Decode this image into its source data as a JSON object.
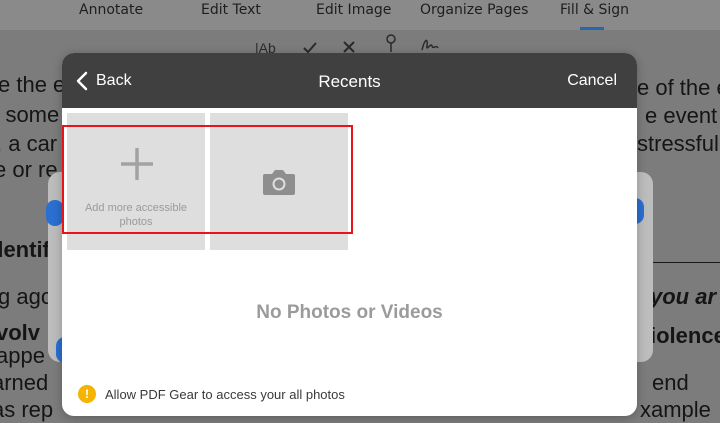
{
  "top_tabs": {
    "items": [
      {
        "label": "Annotate"
      },
      {
        "label": "Edit Text"
      },
      {
        "label": "Edit Image"
      },
      {
        "label": "Organize Pages"
      },
      {
        "label": "Fill & Sign"
      }
    ],
    "active_index": 4,
    "accent_color": "#2866b5"
  },
  "sign_tools": {
    "icons": [
      "text-tool-icon",
      "checkmark-icon",
      "cross-icon",
      "pen-icon",
      "signature-icon"
    ],
    "text_tool_label": "|Ab"
  },
  "background_document": {
    "lines": [
      {
        "text": "e the eve"
      },
      {
        "text": "r some"
      },
      {
        "text": ", a car"
      },
      {
        "text": "e or re"
      },
      {
        "text": "dentif"
      },
      {
        "text": "g ago"
      },
      {
        "text": "volv"
      },
      {
        "text": "appe"
      },
      {
        "text": "arned"
      },
      {
        "text": "as rep"
      },
      {
        "text": "e of the e"
      },
      {
        "text": "e event"
      },
      {
        "text": "stressful"
      },
      {
        "text": "you ar"
      },
      {
        "text": "iolence"
      },
      {
        "text": "end"
      },
      {
        "text": "xample"
      }
    ]
  },
  "dialog": {
    "header": {
      "back_label": "Back",
      "title": "Recents",
      "cancel_label": "Cancel"
    },
    "tiles": {
      "add_label": "Add more accessible photos"
    },
    "empty_message": "No Photos or Videos",
    "permission_prompt": {
      "icon_glyph": "!",
      "label": "Allow PDF Gear to access your all photos",
      "icon_color": "#f4b400"
    },
    "highlight_color": "#e8141c"
  }
}
